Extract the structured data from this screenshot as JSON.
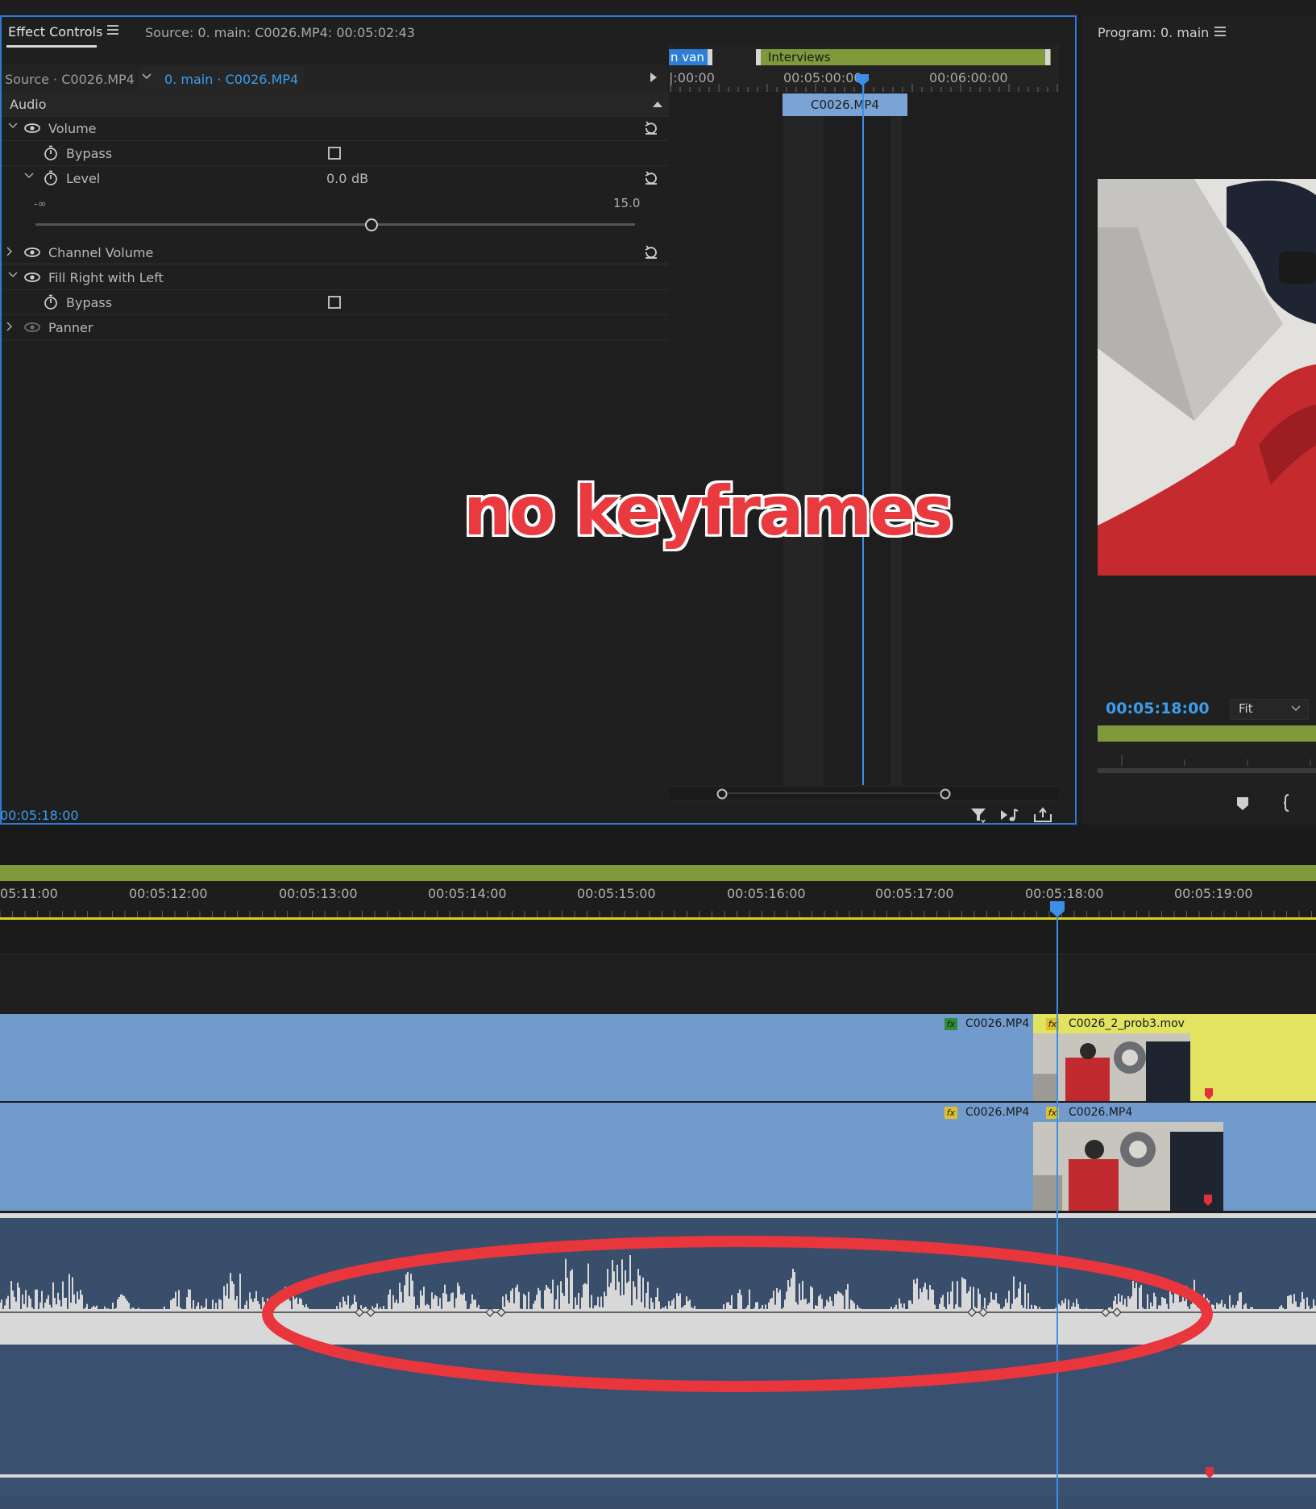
{
  "effect_controls": {
    "tab_label": "Effect Controls",
    "source_title": "Source: 0. main: C0026.MP4: 00:05:02:43",
    "source_label": "Source · C0026.MP4",
    "sequence_label": "0. main · C0026.MP4",
    "section_audio": "Audio",
    "rows": {
      "volume": "Volume",
      "bypass1": "Bypass",
      "level": "Level",
      "level_value": "0.0",
      "level_unit": "dB",
      "slider_min": "-∞",
      "slider_max": "15.0",
      "channel_volume": "Channel Volume",
      "fill_right_with_left": "Fill Right with Left",
      "bypass2": "Bypass",
      "panner": "Panner"
    },
    "ruler": {
      "label_van": "n van",
      "label_interviews": "Interviews",
      "tc1": "|:00:00",
      "tc2": "00:05:00:00",
      "tc3": "00:06:00:00"
    },
    "clip_label": "C0026.MP4",
    "current_timecode": "00:05:18:00"
  },
  "overlay_caption": "no keyframes",
  "program": {
    "title": "Program: 0. main",
    "timecode": "00:05:18:00",
    "fit_label": "Fit"
  },
  "timeline": {
    "timecodes": [
      "05:11:00",
      "00:05:12:00",
      "00:05:13:00",
      "00:05:14:00",
      "00:05:15:00",
      "00:05:16:00",
      "00:05:17:00",
      "00:05:18:00",
      "00:05:19:00"
    ],
    "v_track1": {
      "clip_a": "C0026.MP4",
      "clip_b": "C0026_2_prob3.mov"
    },
    "v_track2": {
      "clip_a": "C0026.MP4",
      "clip_b": "C0026.MP4"
    }
  },
  "colors": {
    "accent_blue": "#3c9ded",
    "clip_blue": "#729bcd",
    "clip_yellow": "#e2e360",
    "workarea_green": "#7e9a3a",
    "annotation_red": "#e83a3f"
  }
}
